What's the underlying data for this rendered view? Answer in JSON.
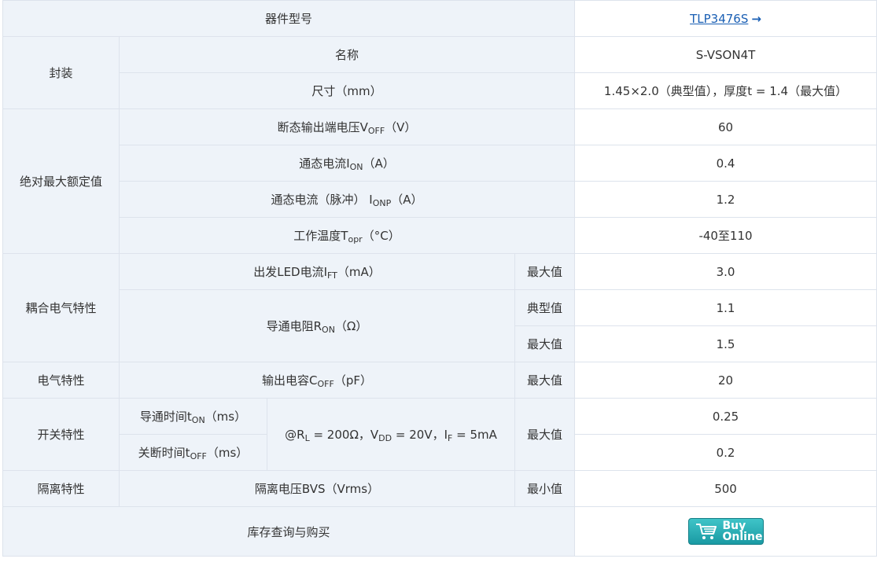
{
  "header": {
    "label": "器件型号",
    "part_number": "TLP3476S",
    "arrow": "→"
  },
  "package": {
    "group": "封装",
    "name_label": "名称",
    "name_value": "S-VSON4T",
    "size_label": "尺寸（mm）",
    "size_value": "1.45×2.0（典型值），厚度t = 1.4（最大值）"
  },
  "abs_max": {
    "group": "绝对最大额定值",
    "voff": {
      "pre": "断态输出端电压V",
      "sub": "OFF",
      "post": "（V）",
      "value": "60"
    },
    "ion": {
      "pre": "通态电流I",
      "sub": "ON",
      "post": "（A）",
      "value": "0.4"
    },
    "ionp": {
      "pre": "通态电流（脉冲） I",
      "sub": "ONP",
      "post": "（A）",
      "value": "1.2"
    },
    "topr": {
      "pre": "工作温度T",
      "sub": "opr",
      "post": "（°C）",
      "value": "-40至110"
    }
  },
  "coupled": {
    "group": "耦合电气特性",
    "ift": {
      "pre": "出发LED电流I",
      "sub": "FT",
      "post": "（mA）",
      "cond": "最大值",
      "value": "3.0"
    },
    "ron": {
      "pre": "导通电阻R",
      "sub": "ON",
      "post": "（Ω）",
      "cond1": "典型值",
      "value1": "1.1",
      "cond2": "最大值",
      "value2": "1.5"
    }
  },
  "electrical": {
    "group": "电气特性",
    "coff": {
      "pre": "输出电容C",
      "sub": "OFF",
      "post": "（pF）",
      "cond": "最大值",
      "value": "20"
    }
  },
  "switching": {
    "group": "开关特性",
    "ton": {
      "pre": "导通时间t",
      "sub": "ON",
      "post": "（ms）",
      "value": "0.25"
    },
    "toff": {
      "pre": "关断时间t",
      "sub": "OFF",
      "post": "（ms）",
      "value": "0.2"
    },
    "condition": {
      "p1": "@R",
      "s1": "L",
      "p2": " = 200Ω，V",
      "s2": "DD",
      "p3": " = 20V，I",
      "s3": "F",
      "p4": " = 5mA"
    },
    "cond": "最大值"
  },
  "isolation": {
    "group": "隔离特性",
    "label": "隔离电压BVS（Vrms）",
    "cond": "最小值",
    "value": "500"
  },
  "stock": {
    "label": "库存查询与购买",
    "buy_line1": "Buy",
    "buy_line2": "Online",
    "icon": "cart-icon"
  },
  "colors": {
    "label_bg": "#eef3f9",
    "border": "#dde3ec",
    "link": "#1a5fb4",
    "button": "#1a9aa3"
  }
}
